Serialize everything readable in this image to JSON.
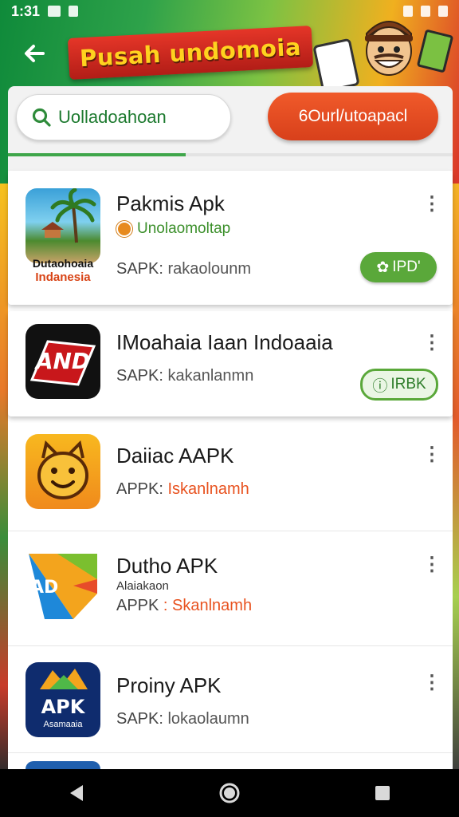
{
  "status_bar": {
    "time": "1:31"
  },
  "header": {
    "title": "Pusah undomoia"
  },
  "search": {
    "text": "Uolladoahoan"
  },
  "download_button": {
    "label": "6Ourl/utoapacl"
  },
  "progress": {
    "fraction": 0.4
  },
  "apps": [
    {
      "title": "Pakmis Apk",
      "tag": "Unolaomoltap",
      "sub_label": "SAPK:",
      "sub_value": " rakaolounm",
      "icon_caption_1": "Dutaohoaia",
      "icon_caption_2": "Indanesia",
      "button_label": "IPD'",
      "button_icon": "gear-icon"
    },
    {
      "title": "IMoahaia Iaan Indoaaia",
      "sub_label": "SAPK:",
      "sub_value": " kakanlanmn",
      "icon_text": "AND",
      "button_label": "IRBK",
      "button_icon": "info-icon"
    },
    {
      "title": "Daiiac AAPK",
      "sub_label": "APPK:",
      "sub_value": " Iskanlnamh"
    },
    {
      "title": "Dutho APK",
      "mini": "Alaiakaon",
      "sub_label": "APPK",
      "sub_value": " : Skanlnamh",
      "icon_text": "AD"
    },
    {
      "title": "Proiny APK",
      "sub_label": "SAPK:",
      "sub_value": " lokaolaumn",
      "icon_text": "APK",
      "icon_caption": "Asamaaia"
    }
  ],
  "colors": {
    "accent_green": "#5aa83a",
    "accent_orange": "#e8521f",
    "banner_red": "#c9261d",
    "banner_text": "#ffd21f"
  }
}
